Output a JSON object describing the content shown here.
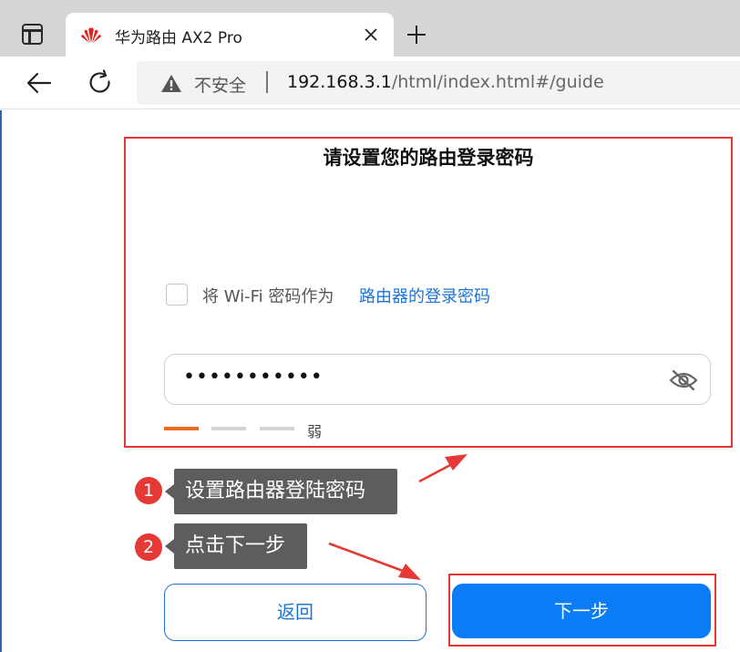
{
  "browser": {
    "tab": {
      "title": "华为路由 AX2 Pro",
      "favicon": "huawei-logo",
      "close_icon": "close-icon"
    },
    "new_tab_icon": "plus-icon",
    "toolbar": {
      "back_icon": "arrow-left-icon",
      "reload_icon": "reload-icon"
    },
    "address": {
      "warning_icon": "warning-triangle-icon",
      "security_label": "不安全",
      "separator": "|",
      "host": "192.168.3.1",
      "path": "/html/index.html#/guide"
    }
  },
  "form": {
    "heading": "请设置您的路由登录密码",
    "checkbox_label": "将 Wi-Fi 密码作为",
    "checkbox_link": "路由器的登录密码",
    "checkbox_checked": false,
    "password_value": "•••••••••••",
    "eye_icon": "eye-slash-icon",
    "strength_level": 1,
    "strength_levels_total": 3,
    "strength_label": "弱"
  },
  "annotations": {
    "step1_number": "1",
    "step1_text": "设置路由器登陆密码",
    "step2_number": "2",
    "step2_text": "点击下一步",
    "highlight_color": "#e53935"
  },
  "buttons": {
    "back_label": "返回",
    "next_label": "下一步"
  },
  "colors": {
    "primary": "#0a7cf5",
    "link": "#1e74d6",
    "strength_weak": "#e96b1d",
    "annotation_bg": "#5d5d5d"
  }
}
